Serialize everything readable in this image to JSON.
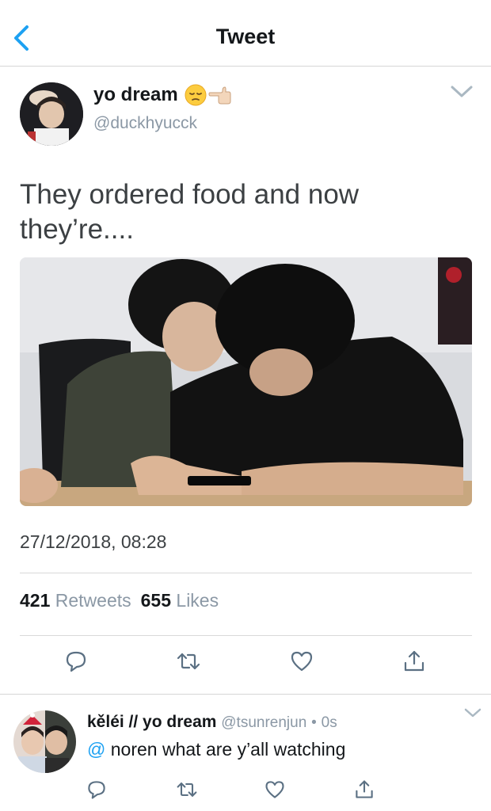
{
  "navbar": {
    "title": "Tweet",
    "back_icon": "chevron-left-icon"
  },
  "tweet": {
    "display_name": "yo dream",
    "name_emojis": [
      "pensive-face-emoji",
      "pointing-left-hand-emoji"
    ],
    "handle": "@duckhyucck",
    "text": "They ordered food and now they’re....",
    "media_description": "photo",
    "timestamp": "27/12/2018, 08:28",
    "retweets_count": "421",
    "retweets_label": "Retweets",
    "likes_count": "655",
    "likes_label": "Likes",
    "actions": [
      "reply-icon",
      "retweet-icon",
      "like-icon",
      "share-icon"
    ]
  },
  "reply": {
    "display_name": "kěléi // yo dream",
    "handle": "@tsunrenjun",
    "separator": "•",
    "time": "0s",
    "mention": "@",
    "text": "noren what are y’all watching",
    "actions": [
      "reply-icon",
      "retweet-icon",
      "like-icon",
      "share-icon"
    ]
  },
  "colors": {
    "link": "#1da1f2",
    "secondary_text": "#8b98a5",
    "divider": "#d9d9d9",
    "icon": "#5b7083"
  }
}
